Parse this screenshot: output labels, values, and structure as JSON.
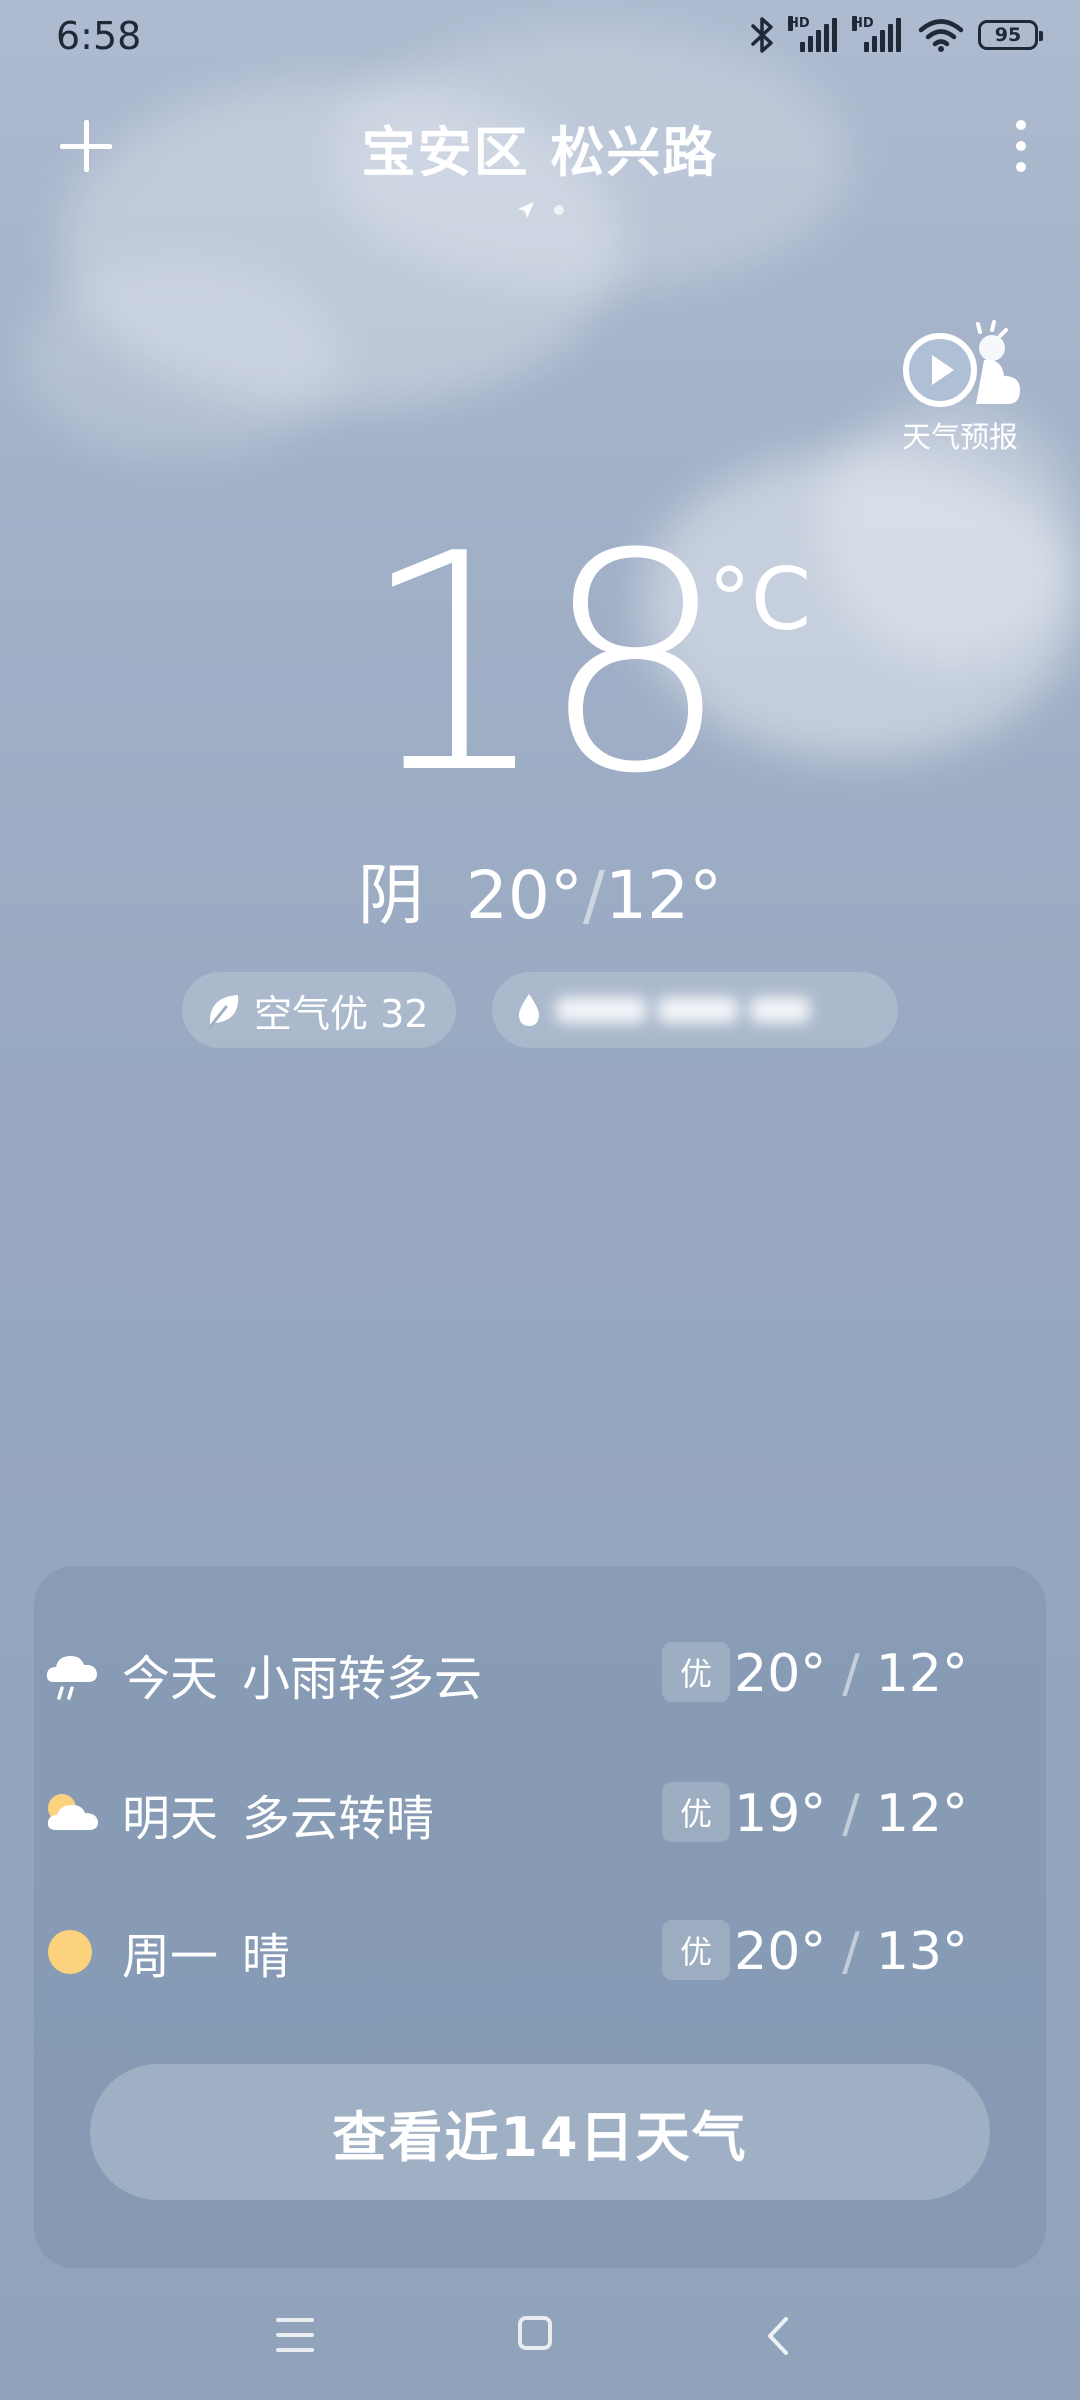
{
  "status_bar": {
    "time": "6:58",
    "hd1": "HD",
    "hd2": "HD",
    "battery": "95"
  },
  "header": {
    "location": "宝安区 松兴路"
  },
  "forecast_video": {
    "label": "天气预报"
  },
  "current": {
    "temp": "18",
    "unit": "°C",
    "condition": "阴",
    "high": "20°",
    "low": "12°",
    "separator": "/"
  },
  "chips": {
    "air_quality": "空气优 32"
  },
  "daily": [
    {
      "day": "今天",
      "desc": "小雨转多云",
      "aq": "优",
      "high": "20°",
      "low": "12°",
      "icon": "rain-cloud-icon"
    },
    {
      "day": "明天",
      "desc": "多云转晴",
      "aq": "优",
      "high": "19°",
      "low": "12°",
      "icon": "partly-cloudy-icon"
    },
    {
      "day": "周一",
      "desc": "晴",
      "aq": "优",
      "high": "20°",
      "low": "13°",
      "icon": "sun-icon"
    }
  ],
  "range_sep": "/",
  "view_14_days": "查看近14日天气",
  "colors": {
    "sun": "#fcd27e",
    "text": "#ffffff",
    "status_text": "#1f2937"
  }
}
